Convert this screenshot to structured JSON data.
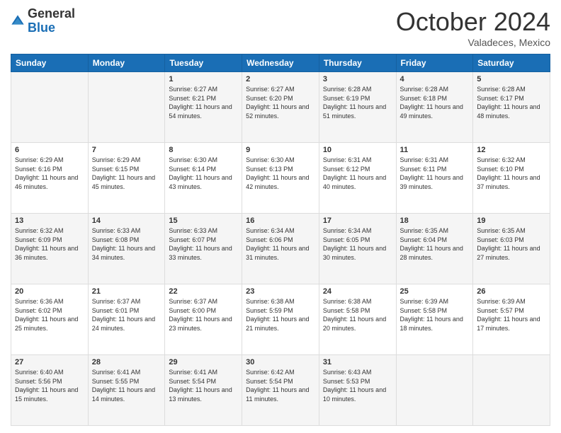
{
  "header": {
    "logo": {
      "general": "General",
      "blue": "Blue"
    },
    "title": "October 2024",
    "location": "Valadeces, Mexico"
  },
  "weekdays": [
    "Sunday",
    "Monday",
    "Tuesday",
    "Wednesday",
    "Thursday",
    "Friday",
    "Saturday"
  ],
  "weeks": [
    [
      {
        "day": "",
        "content": ""
      },
      {
        "day": "",
        "content": ""
      },
      {
        "day": "1",
        "sunrise": "6:27 AM",
        "sunset": "6:21 PM",
        "daylight": "11 hours and 54 minutes."
      },
      {
        "day": "2",
        "sunrise": "6:27 AM",
        "sunset": "6:20 PM",
        "daylight": "11 hours and 52 minutes."
      },
      {
        "day": "3",
        "sunrise": "6:28 AM",
        "sunset": "6:19 PM",
        "daylight": "11 hours and 51 minutes."
      },
      {
        "day": "4",
        "sunrise": "6:28 AM",
        "sunset": "6:18 PM",
        "daylight": "11 hours and 49 minutes."
      },
      {
        "day": "5",
        "sunrise": "6:28 AM",
        "sunset": "6:17 PM",
        "daylight": "11 hours and 48 minutes."
      }
    ],
    [
      {
        "day": "6",
        "sunrise": "6:29 AM",
        "sunset": "6:16 PM",
        "daylight": "11 hours and 46 minutes."
      },
      {
        "day": "7",
        "sunrise": "6:29 AM",
        "sunset": "6:15 PM",
        "daylight": "11 hours and 45 minutes."
      },
      {
        "day": "8",
        "sunrise": "6:30 AM",
        "sunset": "6:14 PM",
        "daylight": "11 hours and 43 minutes."
      },
      {
        "day": "9",
        "sunrise": "6:30 AM",
        "sunset": "6:13 PM",
        "daylight": "11 hours and 42 minutes."
      },
      {
        "day": "10",
        "sunrise": "6:31 AM",
        "sunset": "6:12 PM",
        "daylight": "11 hours and 40 minutes."
      },
      {
        "day": "11",
        "sunrise": "6:31 AM",
        "sunset": "6:11 PM",
        "daylight": "11 hours and 39 minutes."
      },
      {
        "day": "12",
        "sunrise": "6:32 AM",
        "sunset": "6:10 PM",
        "daylight": "11 hours and 37 minutes."
      }
    ],
    [
      {
        "day": "13",
        "sunrise": "6:32 AM",
        "sunset": "6:09 PM",
        "daylight": "11 hours and 36 minutes."
      },
      {
        "day": "14",
        "sunrise": "6:33 AM",
        "sunset": "6:08 PM",
        "daylight": "11 hours and 34 minutes."
      },
      {
        "day": "15",
        "sunrise": "6:33 AM",
        "sunset": "6:07 PM",
        "daylight": "11 hours and 33 minutes."
      },
      {
        "day": "16",
        "sunrise": "6:34 AM",
        "sunset": "6:06 PM",
        "daylight": "11 hours and 31 minutes."
      },
      {
        "day": "17",
        "sunrise": "6:34 AM",
        "sunset": "6:05 PM",
        "daylight": "11 hours and 30 minutes."
      },
      {
        "day": "18",
        "sunrise": "6:35 AM",
        "sunset": "6:04 PM",
        "daylight": "11 hours and 28 minutes."
      },
      {
        "day": "19",
        "sunrise": "6:35 AM",
        "sunset": "6:03 PM",
        "daylight": "11 hours and 27 minutes."
      }
    ],
    [
      {
        "day": "20",
        "sunrise": "6:36 AM",
        "sunset": "6:02 PM",
        "daylight": "11 hours and 25 minutes."
      },
      {
        "day": "21",
        "sunrise": "6:37 AM",
        "sunset": "6:01 PM",
        "daylight": "11 hours and 24 minutes."
      },
      {
        "day": "22",
        "sunrise": "6:37 AM",
        "sunset": "6:00 PM",
        "daylight": "11 hours and 23 minutes."
      },
      {
        "day": "23",
        "sunrise": "6:38 AM",
        "sunset": "5:59 PM",
        "daylight": "11 hours and 21 minutes."
      },
      {
        "day": "24",
        "sunrise": "6:38 AM",
        "sunset": "5:58 PM",
        "daylight": "11 hours and 20 minutes."
      },
      {
        "day": "25",
        "sunrise": "6:39 AM",
        "sunset": "5:58 PM",
        "daylight": "11 hours and 18 minutes."
      },
      {
        "day": "26",
        "sunrise": "6:39 AM",
        "sunset": "5:57 PM",
        "daylight": "11 hours and 17 minutes."
      }
    ],
    [
      {
        "day": "27",
        "sunrise": "6:40 AM",
        "sunset": "5:56 PM",
        "daylight": "11 hours and 15 minutes."
      },
      {
        "day": "28",
        "sunrise": "6:41 AM",
        "sunset": "5:55 PM",
        "daylight": "11 hours and 14 minutes."
      },
      {
        "day": "29",
        "sunrise": "6:41 AM",
        "sunset": "5:54 PM",
        "daylight": "11 hours and 13 minutes."
      },
      {
        "day": "30",
        "sunrise": "6:42 AM",
        "sunset": "5:54 PM",
        "daylight": "11 hours and 11 minutes."
      },
      {
        "day": "31",
        "sunrise": "6:43 AM",
        "sunset": "5:53 PM",
        "daylight": "11 hours and 10 minutes."
      },
      {
        "day": "",
        "content": ""
      },
      {
        "day": "",
        "content": ""
      }
    ]
  ],
  "labels": {
    "sunrise": "Sunrise:",
    "sunset": "Sunset:",
    "daylight": "Daylight:"
  }
}
